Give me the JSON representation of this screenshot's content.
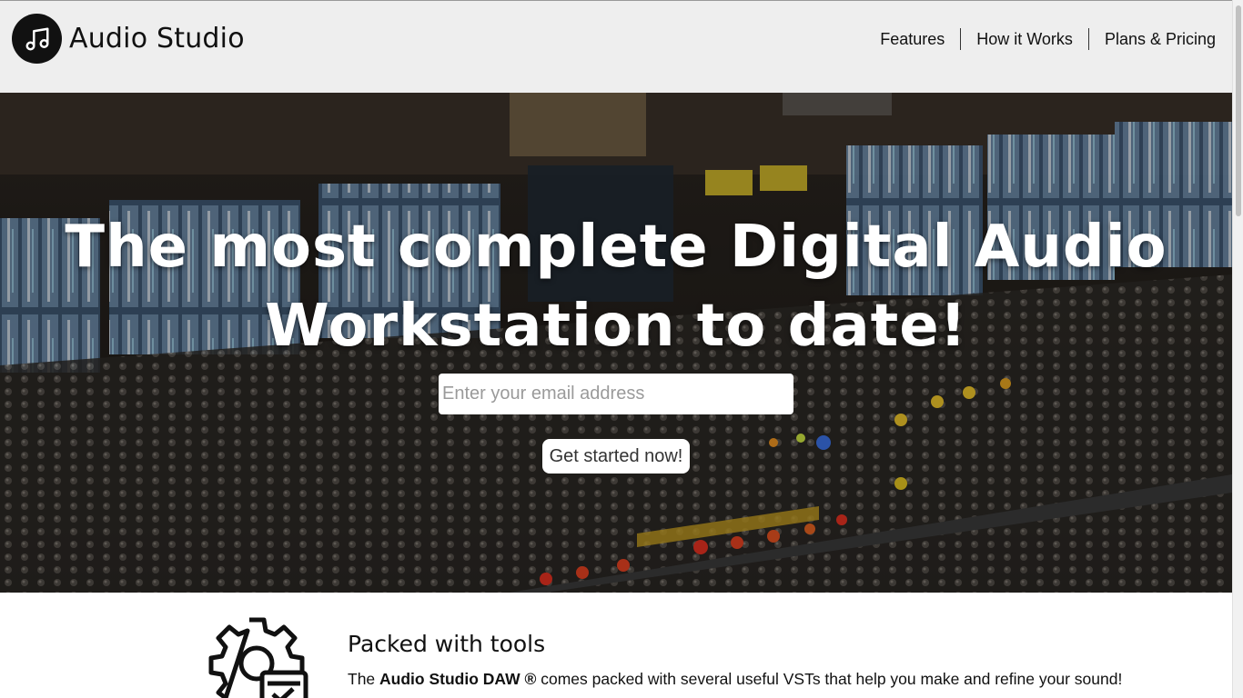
{
  "header": {
    "brand_name": "Audio Studio",
    "logo_icon": "music-note-icon",
    "nav": [
      {
        "label": "Features"
      },
      {
        "label": "How it Works"
      },
      {
        "label": "Plans & Pricing"
      }
    ],
    "background": "#eeeeee"
  },
  "hero": {
    "title": "The most complete Digital Audio Workstation to date!",
    "email_placeholder": "Enter your email address",
    "email_value": "",
    "cta_label": "Get started now!"
  },
  "feature": {
    "icon": "gear-settings-icon",
    "title": "Packed with tools",
    "desc_prefix": "The ",
    "desc_bold": "Audio Studio DAW ®",
    "desc_suffix": " comes packed with several useful VSTs that help you make and refine your sound!"
  }
}
